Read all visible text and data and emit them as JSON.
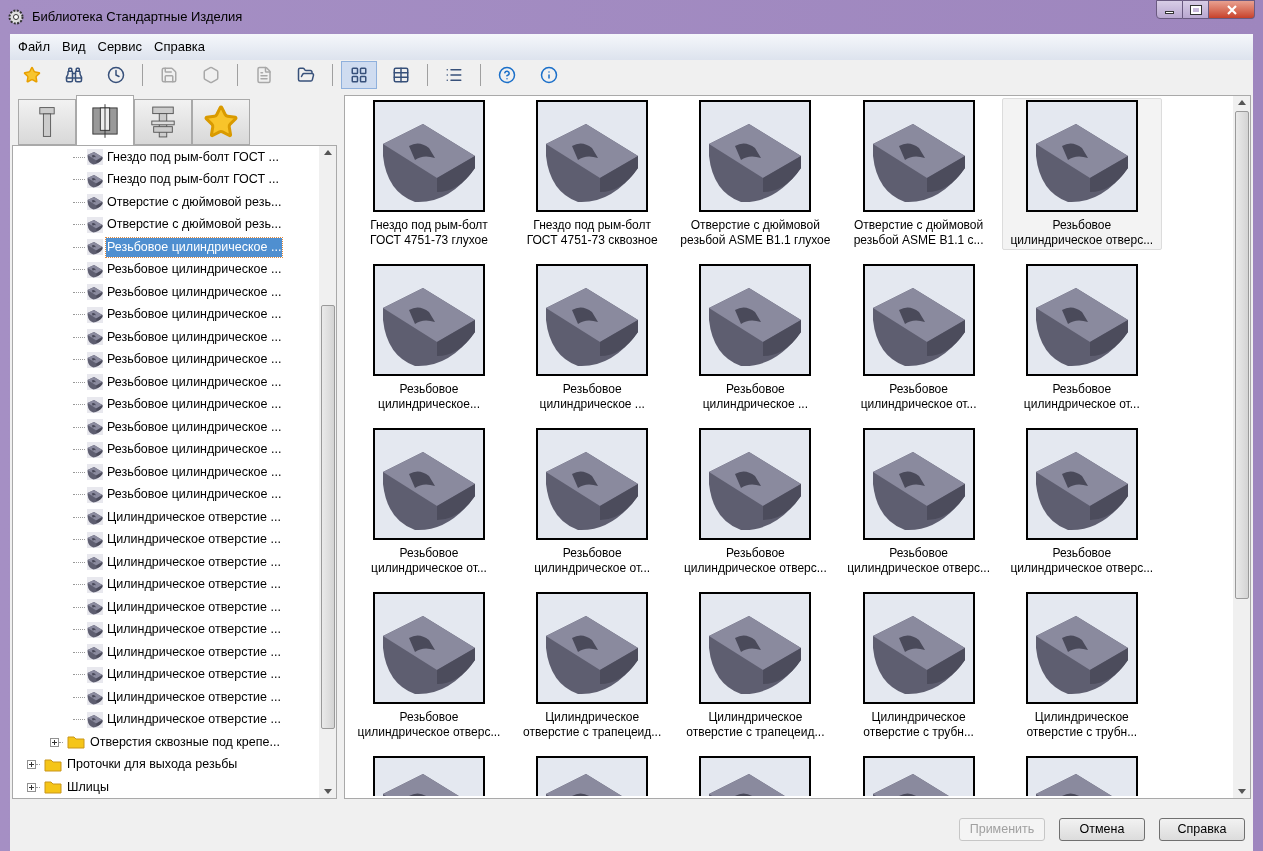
{
  "window": {
    "title": "Библиотека Стандартные Изделия"
  },
  "menu": [
    "Файл",
    "Вид",
    "Сервис",
    "Справка"
  ],
  "toolbar": [
    {
      "kind": "button",
      "disabled": false,
      "selected": false
    },
    {
      "kind": "button",
      "disabled": false,
      "selected": false
    },
    {
      "kind": "button",
      "disabled": false,
      "selected": false
    },
    {
      "kind": "separator"
    },
    {
      "kind": "button",
      "disabled": true,
      "selected": false
    },
    {
      "kind": "button",
      "disabled": true,
      "selected": false
    },
    {
      "kind": "separator"
    },
    {
      "kind": "button",
      "disabled": true,
      "selected": false
    },
    {
      "kind": "button",
      "disabled": false,
      "selected": false
    },
    {
      "kind": "separator"
    },
    {
      "kind": "button",
      "disabled": false,
      "selected": true
    },
    {
      "kind": "button",
      "disabled": false,
      "selected": false
    },
    {
      "kind": "separator"
    },
    {
      "kind": "button",
      "disabled": false,
      "selected": false
    },
    {
      "kind": "separator"
    },
    {
      "kind": "button",
      "disabled": false,
      "selected": false
    },
    {
      "kind": "button",
      "disabled": false,
      "selected": false
    }
  ],
  "tabs": [
    {
      "selected": false
    },
    {
      "selected": true
    },
    {
      "selected": false
    },
    {
      "selected": false
    }
  ],
  "tree": [
    {
      "children": [
        {
          "children": [
            {
              "label": "Гнездо под рым-болт ГОСТ ...",
              "selected": false
            },
            {
              "label": "Гнездо под рым-болт ГОСТ ...",
              "selected": false
            },
            {
              "label": "Отверстие с дюймовой резь...",
              "selected": false
            },
            {
              "label": "Отверстие с дюймовой резь...",
              "selected": false
            },
            {
              "label": "Резьбовое цилиндрическое ...",
              "selected": true
            },
            {
              "label": "Резьбовое цилиндрическое ...",
              "selected": false
            },
            {
              "label": "Резьбовое цилиндрическое ...",
              "selected": false
            },
            {
              "label": "Резьбовое цилиндрическое ...",
              "selected": false
            },
            {
              "label": "Резьбовое цилиндрическое ...",
              "selected": false
            },
            {
              "label": "Резьбовое цилиндрическое ...",
              "selected": false
            },
            {
              "label": "Резьбовое цилиндрическое ...",
              "selected": false
            },
            {
              "label": "Резьбовое цилиндрическое ...",
              "selected": false
            },
            {
              "label": "Резьбовое цилиндрическое ...",
              "selected": false
            },
            {
              "label": "Резьбовое цилиндрическое ...",
              "selected": false
            },
            {
              "label": "Резьбовое цилиндрическое ...",
              "selected": false
            },
            {
              "label": "Резьбовое цилиндрическое ...",
              "selected": false
            },
            {
              "label": "Цилиндрическое отверстие ...",
              "selected": false
            },
            {
              "label": "Цилиндрическое отверстие ...",
              "selected": false
            },
            {
              "label": "Цилиндрическое отверстие ...",
              "selected": false
            },
            {
              "label": "Цилиндрическое отверстие ...",
              "selected": false
            },
            {
              "label": "Цилиндрическое отверстие ...",
              "selected": false
            },
            {
              "label": "Цилиндрическое отверстие ...",
              "selected": false
            },
            {
              "label": "Цилиндрическое отверстие ...",
              "selected": false
            },
            {
              "label": "Цилиндрическое отверстие ...",
              "selected": false
            },
            {
              "label": "Цилиндрическое отверстие ...",
              "selected": false
            },
            {
              "label": "Цилиндрическое отверстие ...",
              "selected": false
            }
          ]
        },
        {
          "label": "Отверстия сквозные под крепе...",
          "expanded": false,
          "selected": false
        }
      ]
    },
    {
      "label": "Проточки для выхода резьбы",
      "expanded": false,
      "selected": false
    },
    {
      "label": "Шлицы",
      "expanded": false,
      "selected": false
    }
  ],
  "items": [
    {
      "label": [
        "Гнездо под рым-болт",
        "ГОСТ 4751-73 глухое"
      ],
      "selected": false
    },
    {
      "label": [
        "Гнездо под рым-болт",
        "ГОСТ 4751-73 сквозное"
      ],
      "selected": false
    },
    {
      "label": [
        "Отверстие с дюймовой",
        "резьбой ASME B1.1 глухое"
      ],
      "selected": false
    },
    {
      "label": [
        "Отверстие с дюймовой",
        "резьбой ASME B1.1 с..."
      ],
      "selected": false
    },
    {
      "label": [
        "Резьбовое",
        "цилиндрическое отверс..."
      ],
      "selected": true
    },
    {
      "label": [
        "Резьбовое",
        "цилиндрическое..."
      ],
      "selected": false
    },
    {
      "label": [
        "Резьбовое",
        "цилиндрическое ..."
      ],
      "selected": false
    },
    {
      "label": [
        "Резьбовое",
        "цилиндрическое ..."
      ],
      "selected": false
    },
    {
      "label": [
        "Резьбовое",
        "цилиндрическое от..."
      ],
      "selected": false
    },
    {
      "label": [
        "Резьбовое",
        "цилиндрическое от..."
      ],
      "selected": false
    },
    {
      "label": [
        "Резьбовое",
        "цилиндрическое от..."
      ],
      "selected": false
    },
    {
      "label": [
        "Резьбовое",
        "цилиндрическое от..."
      ],
      "selected": false
    },
    {
      "label": [
        "Резьбовое",
        "цилиндрическое отверс..."
      ],
      "selected": false
    },
    {
      "label": [
        "Резьбовое",
        "цилиндрическое отверс..."
      ],
      "selected": false
    },
    {
      "label": [
        "Резьбовое",
        "цилиндрическое отверс..."
      ],
      "selected": false
    },
    {
      "label": [
        "Резьбовое",
        "цилиндрическое отверс..."
      ],
      "selected": false
    },
    {
      "label": [
        "Цилиндрическое",
        "отверстие с трапецеид..."
      ],
      "selected": false
    },
    {
      "label": [
        "Цилиндрическое",
        "отверстие с трапецеид..."
      ],
      "selected": false
    },
    {
      "label": [
        "Цилиндрическое",
        "отверстие с трубн..."
      ],
      "selected": false
    },
    {
      "label": [
        "Цилиндрическое",
        "отверстие с трубн..."
      ],
      "selected": false
    },
    {
      "selected": false
    },
    {
      "selected": false
    },
    {
      "selected": false
    },
    {
      "selected": false
    },
    {
      "selected": false
    }
  ],
  "buttons": [
    {
      "label": "Применить",
      "disabled": true
    },
    {
      "label": "Отмена",
      "disabled": false
    },
    {
      "label": "Справка",
      "disabled": false
    }
  ]
}
